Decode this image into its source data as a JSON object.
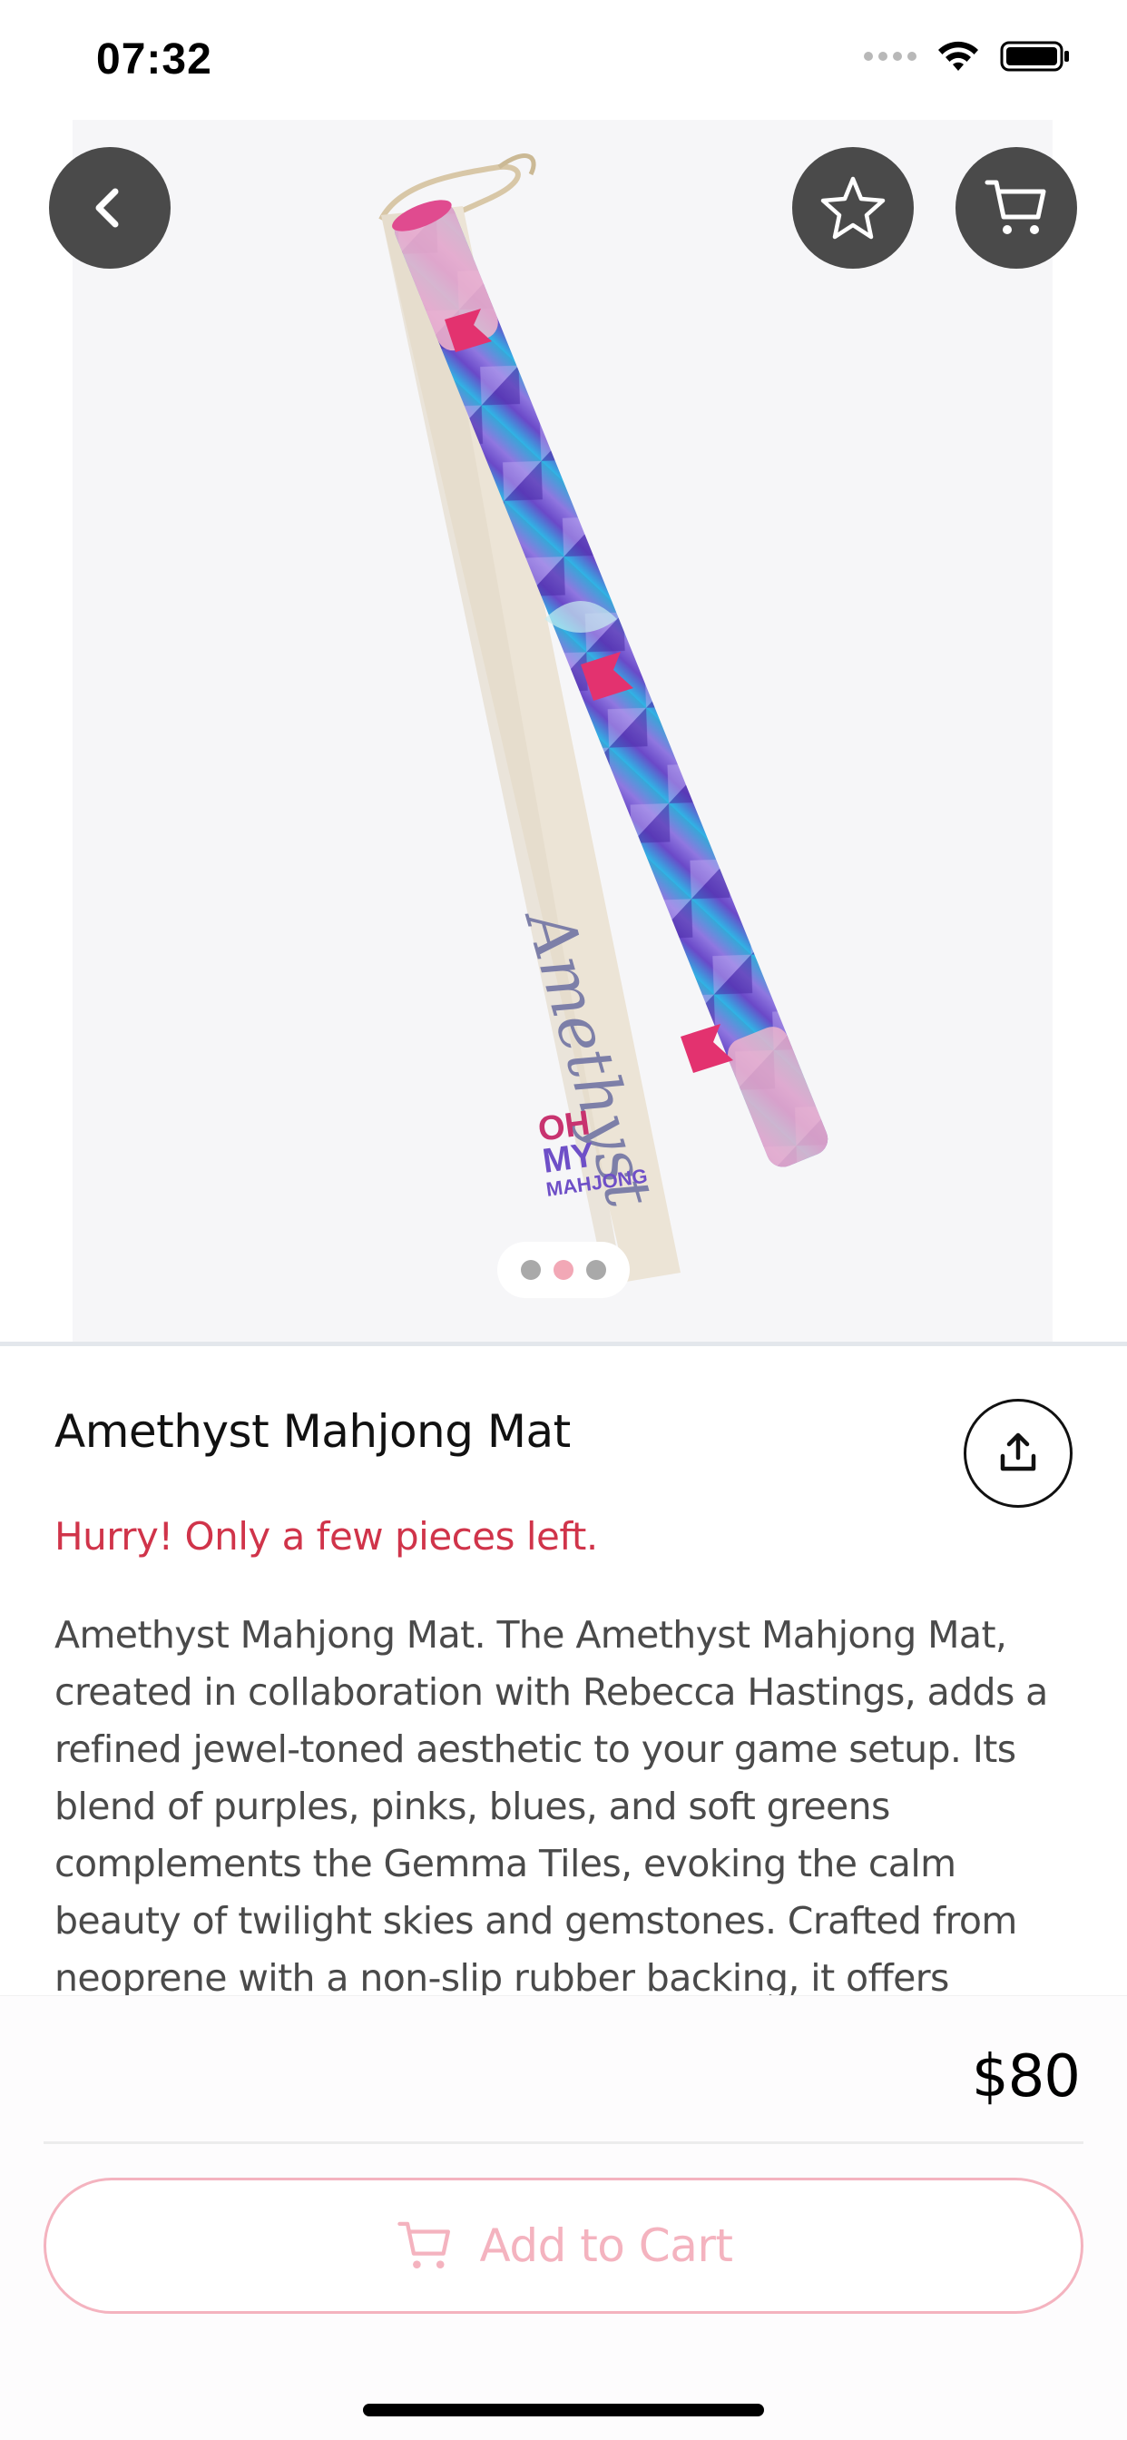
{
  "status_bar": {
    "time": "07:32"
  },
  "product": {
    "title": "Amethyst Mahjong Mat",
    "stock_message": "Hurry! Only a few pieces left.",
    "description": "Amethyst Mahjong Mat. The Amethyst Mahjong Mat, created in collaboration with Rebecca Hastings, adds a refined jewel-toned aesthetic to your game setup. Its blend of purples, pinks, blues, and soft greens complements the Gemma Tiles, evoking the calm beauty of twilight skies and gemstones. Crafted from neoprene with a non-slip rubber backing, it offers durability and",
    "price": "$80",
    "image_text": {
      "bag_script": "Amethyst",
      "logo_line1": "OH",
      "logo_line2": "MY",
      "logo_line3": "MAHJONG"
    },
    "gallery": {
      "count": 3,
      "active_index": 1
    }
  },
  "actions": {
    "add_to_cart_label": "Add to Cart"
  },
  "icons": {
    "back": "chevron-left-icon",
    "favorite": "star-icon",
    "cart": "cart-icon",
    "share": "share-icon",
    "add_to_cart": "cart-icon"
  },
  "colors": {
    "stock_message": "#d0344a",
    "add_to_cart_accent": "#f4b3bf",
    "round_button_bg": "#4a4a4a",
    "pager_active": "#f2a8b6"
  }
}
